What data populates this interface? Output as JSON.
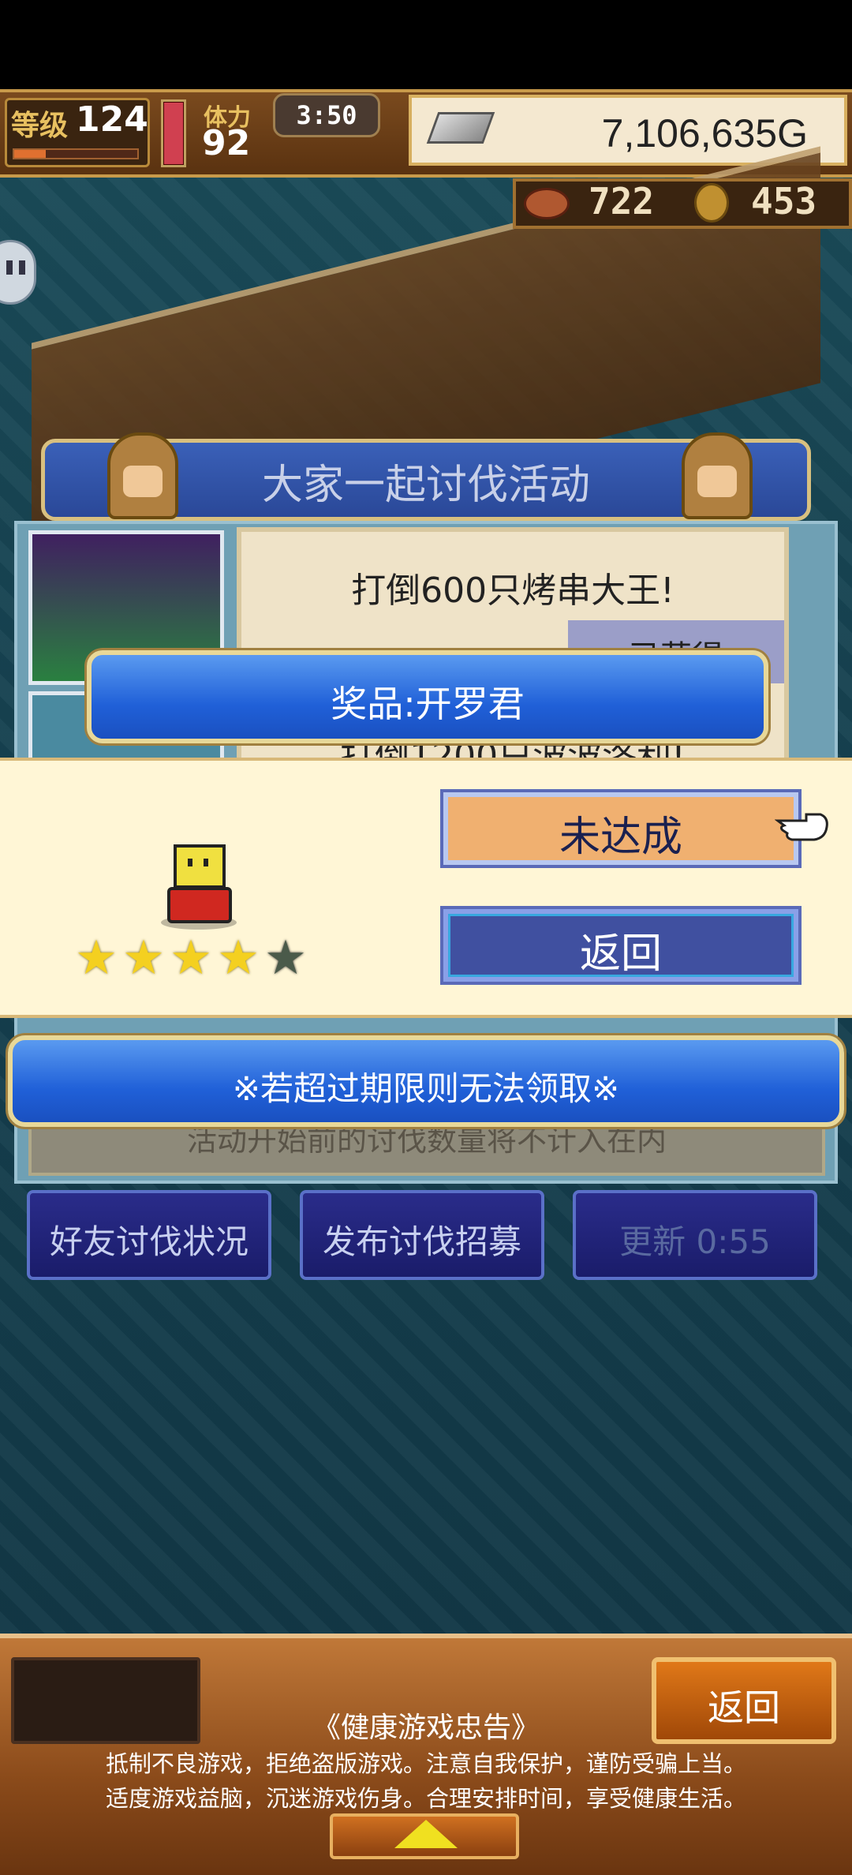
{
  "status": {
    "level_label": "等级",
    "level": "124",
    "stamina_label": "体力",
    "stamina": "92",
    "timer": "3:50",
    "gold": "7,106,635G",
    "resource_a": "722",
    "resource_b": "453"
  },
  "event": {
    "title": "大家一起讨伐活动",
    "task_1": "打倒600只烤串大王!",
    "task_1_status": "已获得",
    "task_2": "打倒1200只波波洛利!",
    "notice": "活动开始前的讨伐数量将不计入在内"
  },
  "popup": {
    "prize": "奖品:开罗君",
    "rating": 4,
    "rating_max": 5,
    "star_glyph": "★",
    "unmet_button": "未达成",
    "back_button": "返回",
    "warning": "※若超过期限则无法领取※"
  },
  "actions": {
    "friends": "好友讨伐状况",
    "recruit": "发布讨伐招募",
    "refresh": "更新 0:55"
  },
  "bottom": {
    "back": "返回",
    "health_title": "《健康游戏忠告》",
    "health_line_1": "抵制不良游戏，拒绝盗版游戏。注意自我保护，谨防受骗上当。",
    "health_line_2": "适度游戏益脑，沉迷游戏伤身。合理安排时间，享受健康生活。"
  },
  "colors": {
    "accent_blue": "#2060d8",
    "popup_bg": "#fff6d6",
    "unmet_orange": "#f0b070",
    "star_on": "#f4d020",
    "star_off": "#4a5a4a"
  },
  "icons": [
    "chat-icon",
    "silver-ingot-icon",
    "meat-icon",
    "coin-icon",
    "pointing-hand-icon",
    "star-icon",
    "up-arrow-icon"
  ]
}
